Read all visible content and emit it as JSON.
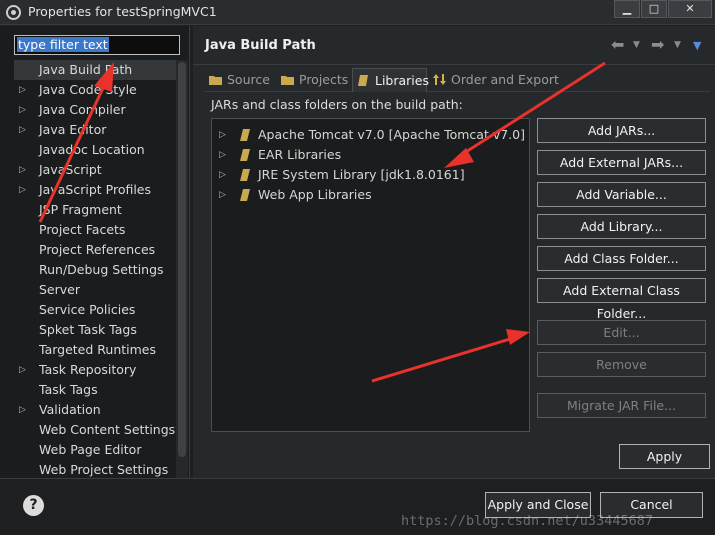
{
  "window": {
    "title": "Properties for testSpringMVC1",
    "minimize_glyph": "▁",
    "maximize_glyph": "□",
    "close_glyph": "✕"
  },
  "filter": {
    "text": "type filter text"
  },
  "sidebar": {
    "items": [
      {
        "label": "Java Build Path",
        "expandable": false,
        "selected": true
      },
      {
        "label": "Java Code Style",
        "expandable": true
      },
      {
        "label": "Java Compiler",
        "expandable": true
      },
      {
        "label": "Java Editor",
        "expandable": true
      },
      {
        "label": "Javadoc Location",
        "expandable": false
      },
      {
        "label": "JavaScript",
        "expandable": true
      },
      {
        "label": "JavaScript Profiles",
        "expandable": true
      },
      {
        "label": "JSP Fragment",
        "expandable": false
      },
      {
        "label": "Project Facets",
        "expandable": false
      },
      {
        "label": "Project References",
        "expandable": false
      },
      {
        "label": "Run/Debug Settings",
        "expandable": false
      },
      {
        "label": "Server",
        "expandable": false
      },
      {
        "label": "Service Policies",
        "expandable": false
      },
      {
        "label": "Spket Task Tags",
        "expandable": false
      },
      {
        "label": "Targeted Runtimes",
        "expandable": false
      },
      {
        "label": "Task Repository",
        "expandable": true
      },
      {
        "label": "Task Tags",
        "expandable": false
      },
      {
        "label": "Validation",
        "expandable": true
      },
      {
        "label": "Web Content Settings",
        "expandable": false
      },
      {
        "label": "Web Page Editor",
        "expandable": false
      },
      {
        "label": "Web Project Settings",
        "expandable": false
      }
    ]
  },
  "main": {
    "title": "Java Build Path",
    "tabs": [
      {
        "label": "Source",
        "active": false
      },
      {
        "label": "Projects",
        "active": false
      },
      {
        "label": "Libraries",
        "active": true
      },
      {
        "label": "Order and Export",
        "active": false
      }
    ],
    "section_label": "JARs and class folders on the build path:",
    "libraries": [
      "Apache Tomcat v7.0 [Apache Tomcat v7.0]",
      "EAR Libraries",
      "JRE System Library [jdk1.8.0161]",
      "Web App Libraries"
    ],
    "buttons": [
      {
        "label": "Add JARs...",
        "enabled": true
      },
      {
        "label": "Add External JARs...",
        "enabled": true
      },
      {
        "label": "Add Variable...",
        "enabled": true
      },
      {
        "label": "Add Library...",
        "enabled": true
      },
      {
        "label": "Add Class Folder...",
        "enabled": true
      },
      {
        "label": "Add External Class Folder...",
        "enabled": true
      },
      {
        "label": "Edit...",
        "enabled": false
      },
      {
        "label": "Remove",
        "enabled": false
      },
      {
        "label": "Migrate JAR File...",
        "enabled": false
      }
    ],
    "apply_label": "Apply"
  },
  "footer": {
    "help_glyph": "?",
    "apply_close_label": "Apply and Close",
    "cancel_label": "Cancel",
    "watermark": "https://blog.csdn.net/u33445687"
  },
  "colors": {
    "annotation_arrow": "#e8322b",
    "selection": "#3b78c9",
    "nav_menu": "#5a8ad8"
  },
  "icons": {
    "nav_back": "arrow-left-icon",
    "nav_forward": "arrow-right-icon",
    "view_menu": "chevron-down-icon",
    "library": "library-book-icon",
    "help": "help-icon"
  }
}
